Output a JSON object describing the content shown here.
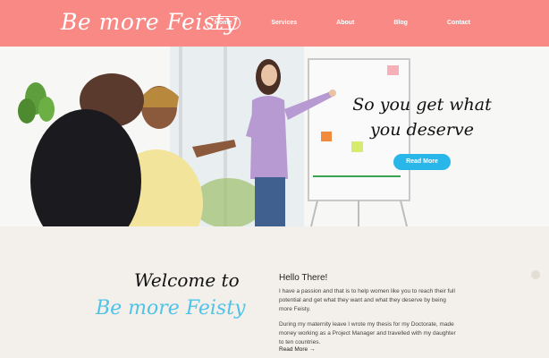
{
  "brand": "Be more Feisty",
  "nav": {
    "items": [
      "Home",
      "Services",
      "About",
      "Blog",
      "Contact"
    ],
    "active": "Home"
  },
  "hero": {
    "tagline_line1": "So you get what",
    "tagline_line2": "you deserve",
    "cta_label": "Read More"
  },
  "intro": {
    "welcome": "Welcome to",
    "brand": "Be more Feisty",
    "hello_title": "Hello There!",
    "paragraph1": "I have a passion and that is to help women like you to reach their full potential and get what they want and what they deserve by being more Feisty.",
    "paragraph2": "During my maternity leave I wrote my thesis for my Doctorate, made money working as a Project Manager and travelled with my daughter to ten countries.",
    "more_link": "Read More →"
  },
  "colors": {
    "header_bg": "#f98985",
    "accent_blue": "#29b6e8",
    "section_bg": "#f3f0eb"
  }
}
